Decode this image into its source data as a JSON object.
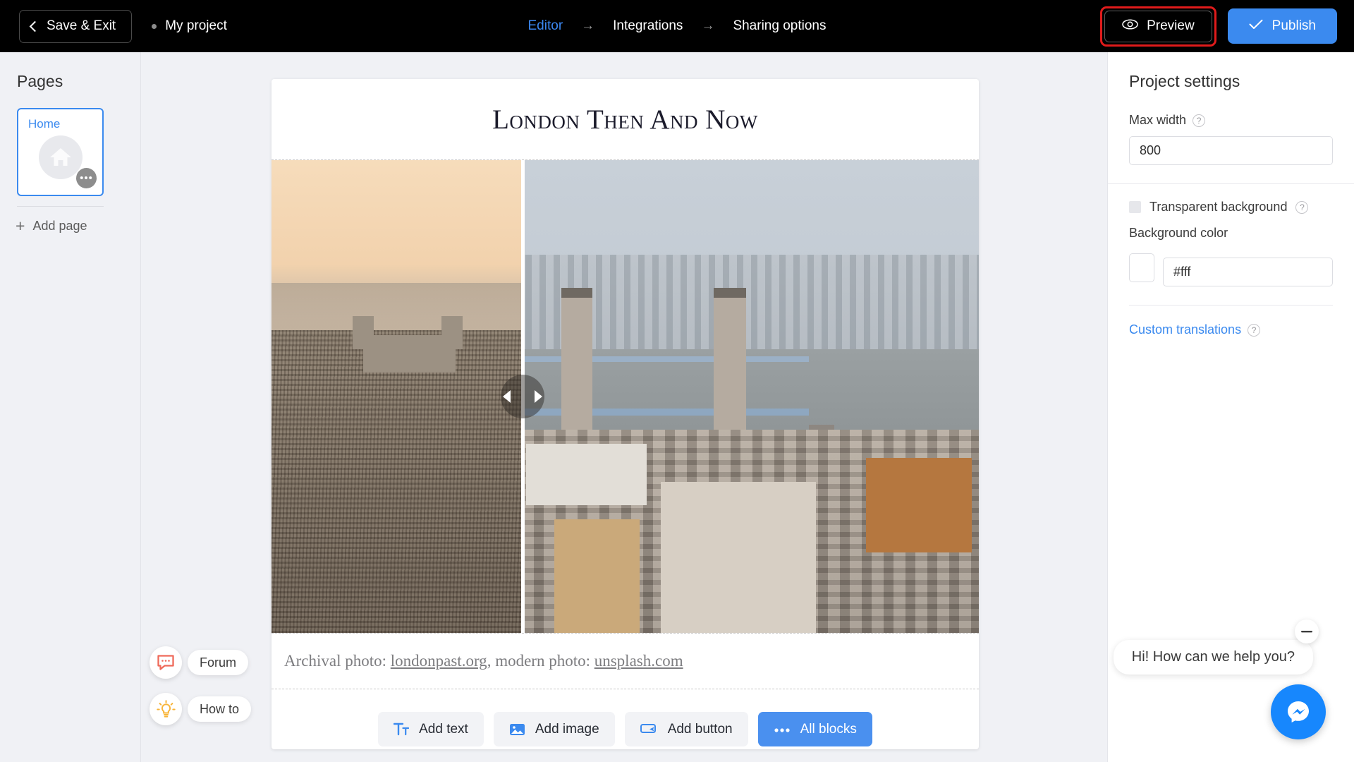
{
  "topbar": {
    "save_exit": "Save & Exit",
    "project_name": "My project",
    "nav": [
      {
        "label": "Editor",
        "active": true
      },
      {
        "label": "Integrations",
        "active": false
      },
      {
        "label": "Sharing options",
        "active": false
      }
    ],
    "nav_arrow": "→",
    "preview": "Preview",
    "publish": "Publish",
    "preview_highlight_color": "#e01b1b",
    "publish_color": "#3b8aef"
  },
  "sidebar": {
    "title": "Pages",
    "pages": [
      {
        "label": "Home",
        "icon": "home-icon",
        "selected": true,
        "menu": "•••"
      }
    ],
    "add_page": "Add page",
    "add_page_icon": "plus-icon"
  },
  "canvas": {
    "page_title": "London Then And Now",
    "image_block": {
      "type": "before-after-slider",
      "slider_position_percent": 35.5,
      "before_label": "archival sepia photo of London skyline with Tower of London",
      "after_label": "modern colour photo of London with Tower Bridge over the Thames"
    },
    "caption": {
      "prefix": "Archival photo: ",
      "link1": "londonpast.org",
      "middle": ", modern photo: ",
      "link2": "unsplash.com"
    },
    "add_blocks": [
      {
        "label": "Add text",
        "icon": "text-icon",
        "primary": false
      },
      {
        "label": "Add image",
        "icon": "image-icon",
        "primary": false
      },
      {
        "label": "Add button",
        "icon": "button-icon",
        "primary": false
      },
      {
        "label": "All blocks",
        "icon": "ellipsis-icon",
        "primary": true
      }
    ]
  },
  "right_panel": {
    "title": "Project settings",
    "max_width_label": "Max width",
    "max_width_value": "800",
    "transparent_bg_label": "Transparent background",
    "transparent_bg_checked": false,
    "background_color_label": "Background color",
    "background_color_value": "#fff",
    "custom_translations": "Custom translations",
    "help_glyph": "?"
  },
  "help": [
    {
      "label": "Forum",
      "icon": "chat-bubble-icon",
      "color": "#ef6a5a"
    },
    {
      "label": "How to",
      "icon": "lightbulb-icon",
      "color": "#f8b438"
    }
  ],
  "chat": {
    "greeting": "Hi! How can we help you?",
    "minimize": "—",
    "fab_icon": "messenger-icon",
    "fab_color": "#1787fd"
  }
}
